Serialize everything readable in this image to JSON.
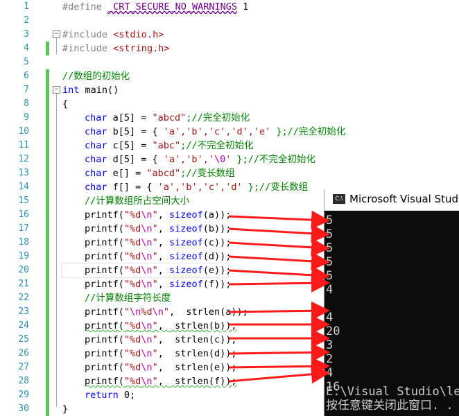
{
  "editor": {
    "line_numbers": [
      "1",
      "2",
      "3",
      "4",
      "5",
      "6",
      "7",
      "8",
      "9",
      "10",
      "11",
      "12",
      "13",
      "14",
      "15",
      "16",
      "17",
      "18",
      "19",
      "20",
      "21",
      "22",
      "23",
      "24",
      "25",
      "26",
      "27",
      "28",
      "29",
      "30"
    ],
    "code": {
      "l1_kw": "#define",
      "l1_name": "_CRT_SECURE_NO_WARNINGS",
      "l1_val": "1",
      "l3_kw": "#include",
      "l3_hdr": "<stdio.h>",
      "l4_kw": "#include",
      "l4_hdr": "<string.h>",
      "l6_cmt": "//数组的初始化",
      "l7_kw": "int",
      "l7_rest": " main()",
      "l8": "{",
      "l9_kw": "char",
      "l9_mid": " a[5] = ",
      "l9_str": "\"abcd\"",
      "l9_cmt": ";//完全初始化",
      "l10_kw": "char",
      "l10_mid": " b[5] = { ",
      "l10_str": "'a','b','c','d','e'",
      "l10_cmt": " };//完全初始化",
      "l11_kw": "char",
      "l11_mid": " c[5] = ",
      "l11_str": "\"abc\"",
      "l11_cmt": ";//不完全初始化",
      "l12_kw": "char",
      "l12_mid": " d[5] = { ",
      "l12_str1": "'a','b','",
      "l12_esc": "\\0",
      "l12_str2": "'",
      "l12_cmt": " };//不完全初始化",
      "l13_kw": "char",
      "l13_mid": " e[] = ",
      "l13_str": "\"abcd\"",
      "l13_cmt": ";//变长数组",
      "l14_kw": "char",
      "l14_mid": " f[] = { ",
      "l14_str": "'a','b','c','d'",
      "l14_cmt": " };//变长数组",
      "l15_cmt": "//计算数组所占空间大小",
      "l16_a": "printf(",
      "l16_s1": "\"%d",
      "l16_e": "\\n",
      "l16_s2": "\"",
      "l16_b": ", ",
      "l16_kw": "sizeof",
      "l16_c": "(a));",
      "l17_c": "(b));",
      "l18_c": "(c));",
      "l19_c": "(d));",
      "l20_c": "(e));",
      "l21_c": "(f));",
      "l22_cmt": "//计算数组字符长度",
      "l23_s1": "\"",
      "l23_e1": "\\n",
      "l23_s2": "%d",
      "l23_e2": "\\n",
      "l23_s3": "\"",
      "strlen": " strlen",
      "l23_c": "(a));",
      "l24_c": "(b));",
      "l25_c": "(c));",
      "l26_c": "(d));",
      "l27_c": "(e));",
      "l28_c": "(f));",
      "l29_kw": "return",
      "l29_rest": " 0;",
      "l30": "}"
    }
  },
  "console": {
    "icon_label": "C:\\",
    "title": "Microsoft Visual Studio",
    "output": [
      "5",
      "5",
      "5",
      "5",
      "5",
      "4",
      "",
      "4",
      "20",
      "3",
      "2",
      "4",
      "16"
    ],
    "path": "E:\\Visual Studio\\lea",
    "prompt": "按任意键关闭此窗口. . ."
  },
  "colors": {
    "keyword": "#0000ff",
    "string": "#a31515",
    "comment": "#008000",
    "line_number": "#2b91af",
    "change_bar": "#58c75a",
    "arrow": "#ff1a1a",
    "console_bg": "#0c0c0c"
  }
}
